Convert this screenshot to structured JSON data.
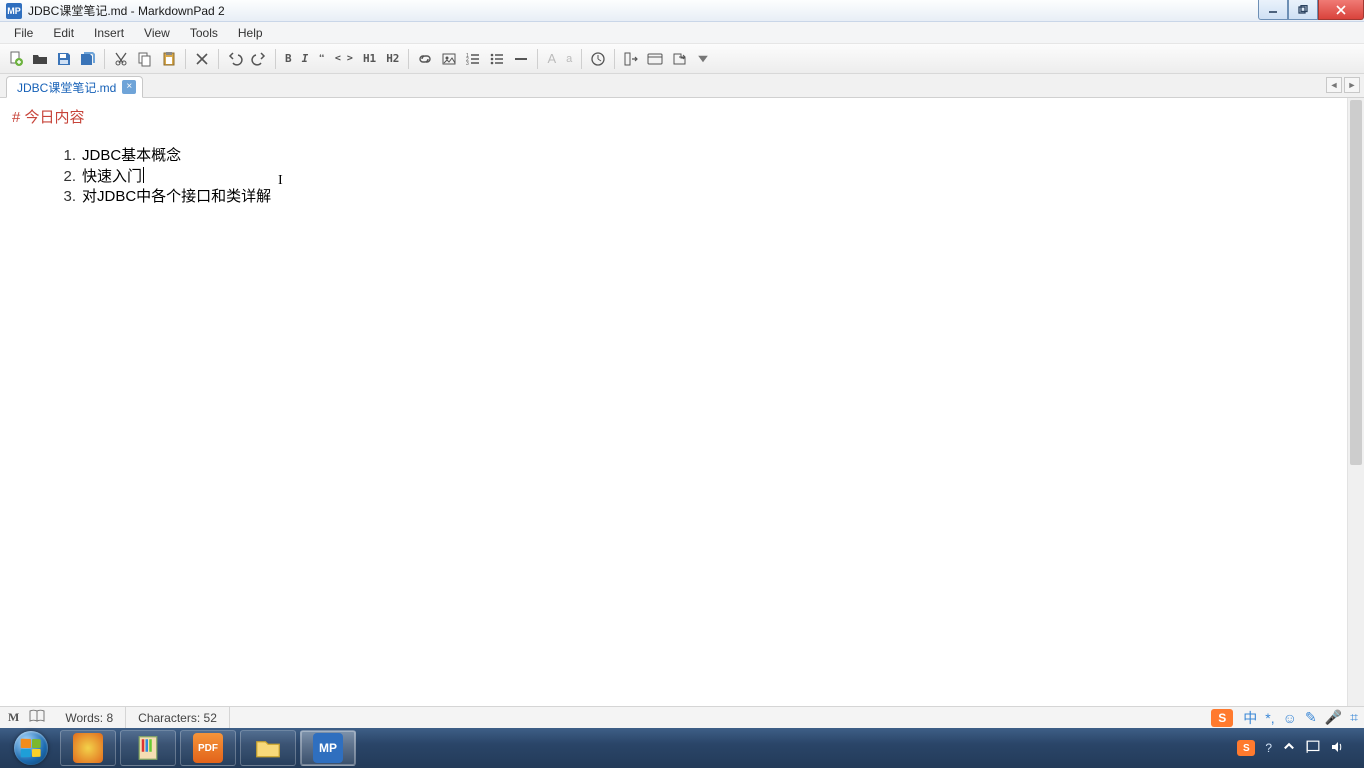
{
  "window": {
    "title": "JDBC课堂笔记.md - MarkdownPad 2",
    "app_icon_text": "MP"
  },
  "menu": {
    "file": "File",
    "edit": "Edit",
    "insert": "Insert",
    "view": "View",
    "tools": "Tools",
    "help": "Help"
  },
  "toolbar": {
    "h1": "H1",
    "h2": "H2",
    "bold": "B",
    "italic": "I",
    "quote": "❝",
    "code": "< >",
    "bigA": "A",
    "smalla": "a"
  },
  "tab": {
    "label": "JDBC课堂笔记.md",
    "close": "×"
  },
  "document": {
    "heading_prefix": "# ",
    "heading_text": "今日内容",
    "items": [
      {
        "n": "1.",
        "t": "JDBC基本概念"
      },
      {
        "n": "2.",
        "t": "快速入门"
      },
      {
        "n": "3.",
        "t": "对JDBC中各个接口和类详解"
      }
    ]
  },
  "status": {
    "words_label": "Words:",
    "words_value": "8",
    "chars_label": "Characters:",
    "chars_value": "52",
    "ime_lang": "中",
    "ime_punct": "*,",
    "ime_face": "☺",
    "ime_pen": "✎",
    "ime_mic": "🎤",
    "ime_grid": "⌗"
  },
  "tray": {
    "time": "",
    "sogou": "S"
  }
}
